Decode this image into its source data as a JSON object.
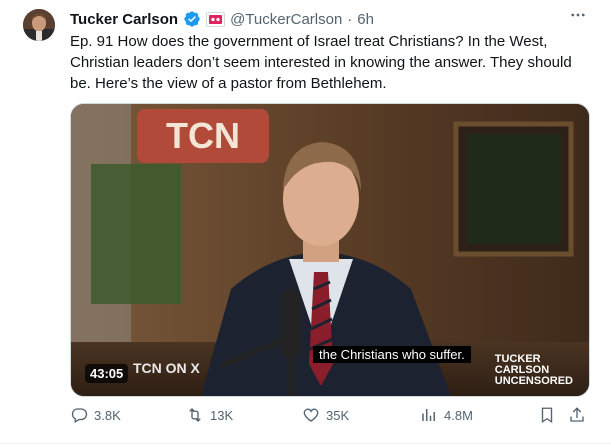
{
  "author": {
    "name": "Tucker Carlson",
    "handle": "@TuckerCarlson",
    "separator": "·",
    "time": "6h"
  },
  "tweet": {
    "text": "Ep. 91  How does the government of Israel treat Christians? In the West, Christian leaders don’t seem interested in knowing the answer. They should be. Here’s the view of a pastor from Bethlehem."
  },
  "video": {
    "sign_text": "TCN",
    "caption": "the Christians who suffer.",
    "duration": "43:05",
    "watermark_left": "TCN ON X",
    "watermark_right_lines": [
      "TUCKER",
      "CARLSON",
      "UNCENSORED"
    ]
  },
  "actions": {
    "replies": "3.8K",
    "reposts": "13K",
    "likes": "35K",
    "views": "4.8M"
  },
  "colors": {
    "text": "#0f1419",
    "secondary": "#536471",
    "verified": "#1d9bf0"
  }
}
